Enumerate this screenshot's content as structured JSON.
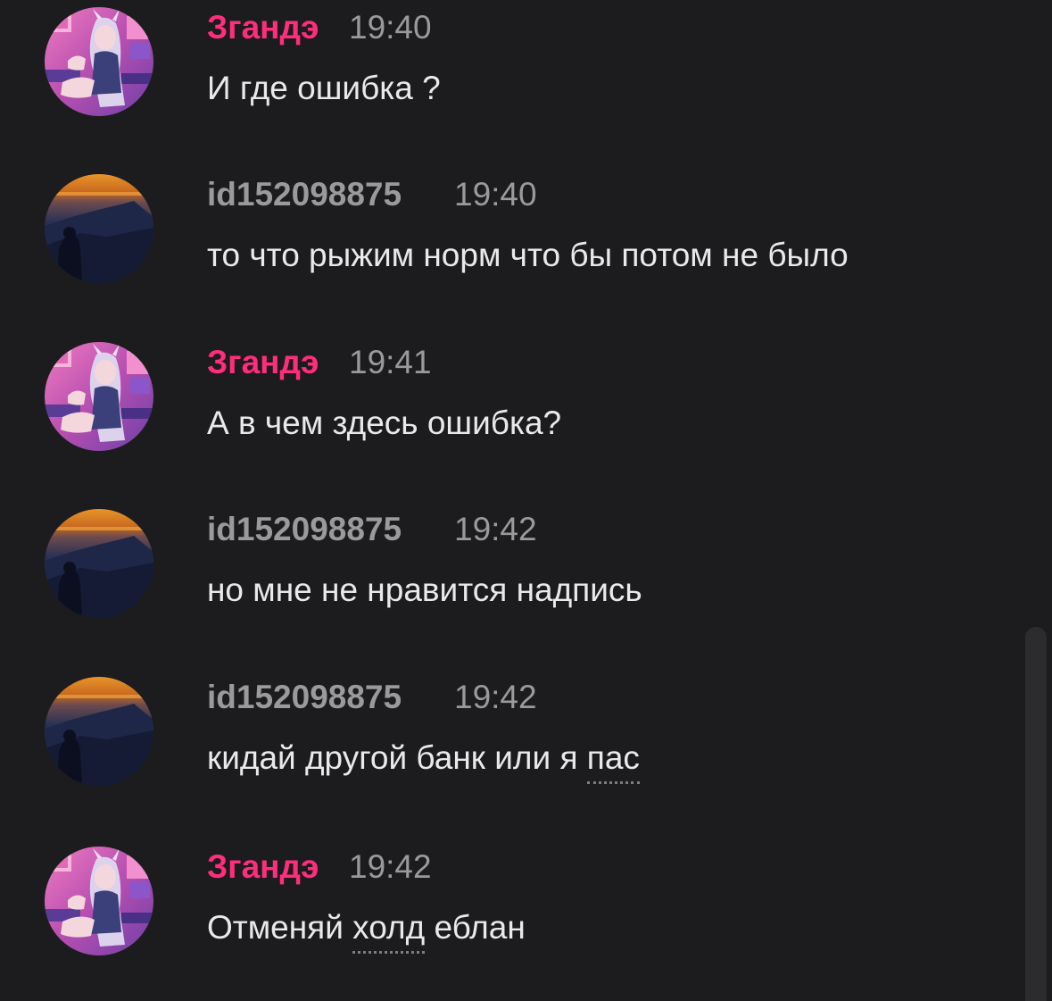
{
  "messages": [
    {
      "author": "Згандэ",
      "time": "19:40",
      "text": "И где ошибка ?",
      "avatar": "anime-girl-avatar"
    },
    {
      "author": "id152098875",
      "time": "19:40",
      "text": "то что рыжим норм что бы потом не было",
      "avatar": "sunset-mountain-avatar"
    },
    {
      "author": "Згандэ",
      "time": "19:41",
      "text": "А в чем здесь ошибка?",
      "avatar": "anime-girl-avatar"
    },
    {
      "author": "id152098875",
      "time": "19:42",
      "text": "но мне не нравится надпись",
      "avatar": "sunset-mountain-avatar"
    },
    {
      "author": "id152098875",
      "time": "19:42",
      "text_before": "кидай другой банк или я ",
      "text_underlined": "пас",
      "avatar": "sunset-mountain-avatar"
    },
    {
      "author": "Згандэ",
      "time": "19:42",
      "text_before": "Отменяй ",
      "text_underlined": "холд",
      "text_after": " еблан",
      "avatar": "anime-girl-avatar"
    }
  ],
  "colors": {
    "background": "#1c1c1e",
    "author_accent": "#ff2d7c",
    "author_muted": "#9a9a9c",
    "message_text": "#e9e9eb"
  }
}
